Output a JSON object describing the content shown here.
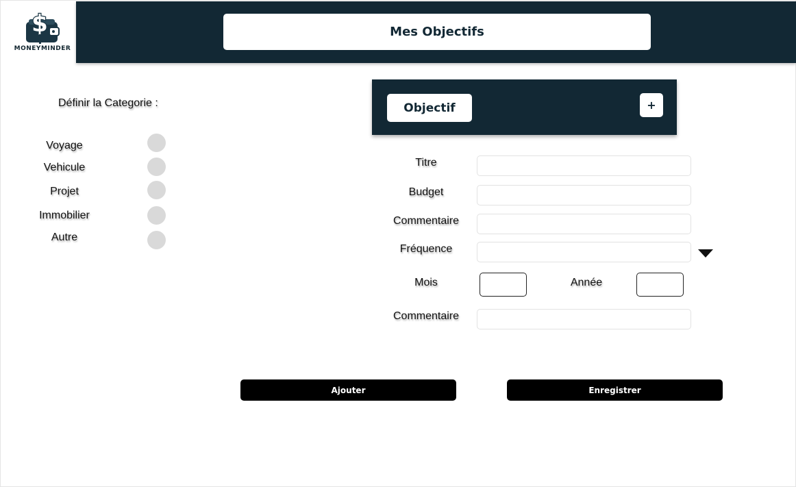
{
  "app": {
    "logo_text": "MONEYMINDER",
    "brand_color": "#122834"
  },
  "header": {
    "title": "Mes Objectifs"
  },
  "categories": {
    "title": "Définir la Categorie :",
    "items": [
      {
        "label": "Voyage"
      },
      {
        "label": "Vehicule"
      },
      {
        "label": "Projet"
      },
      {
        "label": "Immobilier"
      },
      {
        "label": "Autre"
      }
    ]
  },
  "objectif": {
    "tab_label": "Objectif",
    "add_label": "+"
  },
  "form": {
    "titre": {
      "label": "Titre",
      "value": ""
    },
    "budget": {
      "label": "Budget",
      "value": ""
    },
    "commentaire1": {
      "label": "Commentaire",
      "value": ""
    },
    "frequence": {
      "label": "Fréquence",
      "value": "",
      "icon": "caret-down-icon"
    },
    "mois": {
      "label": "Mois",
      "value": ""
    },
    "annee": {
      "label": "Année",
      "value": ""
    },
    "commentaire2": {
      "label": "Commentaire",
      "value": ""
    }
  },
  "buttons": {
    "ajouter": "Ajouter",
    "enregistrer": "Enregistrer"
  }
}
